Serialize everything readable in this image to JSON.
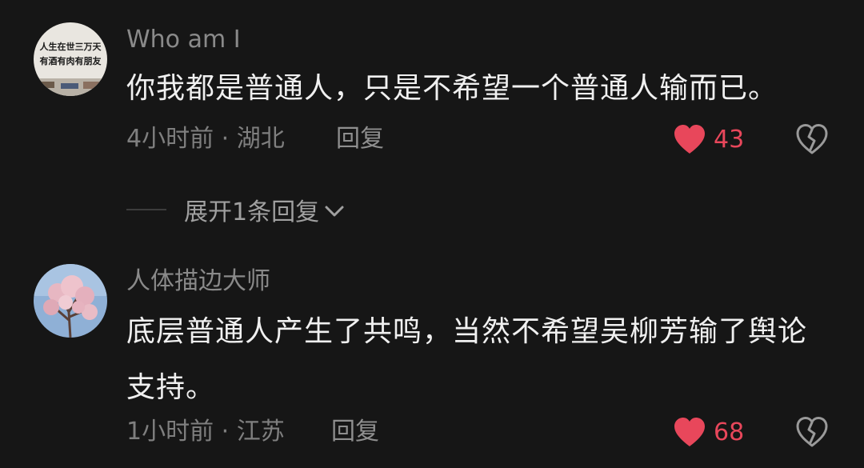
{
  "comments": [
    {
      "avatar": {
        "icon": "handwritten-text-avatar",
        "text_lines": [
          "人生在世三万天",
          "有酒有肉有朋友"
        ]
      },
      "username": "Who am I",
      "content": "你我都是普通人，只是不希望一个普通人输而已。",
      "meta": "4小时前 · 湖北",
      "reply_label": "回复",
      "likes": "43",
      "like_icon": "heart-filled-icon",
      "dislike_icon": "broken-heart-icon"
    },
    {
      "avatar": {
        "icon": "blossom-tree-avatar"
      },
      "username": "人体描边大师",
      "content": "底层普通人产生了共鸣，当然不希望吴柳芳输了舆论支持。",
      "meta": "1小时前 · 江苏",
      "reply_label": "回复",
      "likes": "68",
      "like_icon": "heart-filled-icon",
      "dislike_icon": "broken-heart-icon"
    }
  ],
  "expand_replies": {
    "label": "展开1条回复",
    "icon": "chevron-down-icon"
  },
  "colors": {
    "background": "#161616",
    "like_red": "#e8475b",
    "muted_text": "#8a8a8a",
    "body_text": "#f0f0f0"
  }
}
